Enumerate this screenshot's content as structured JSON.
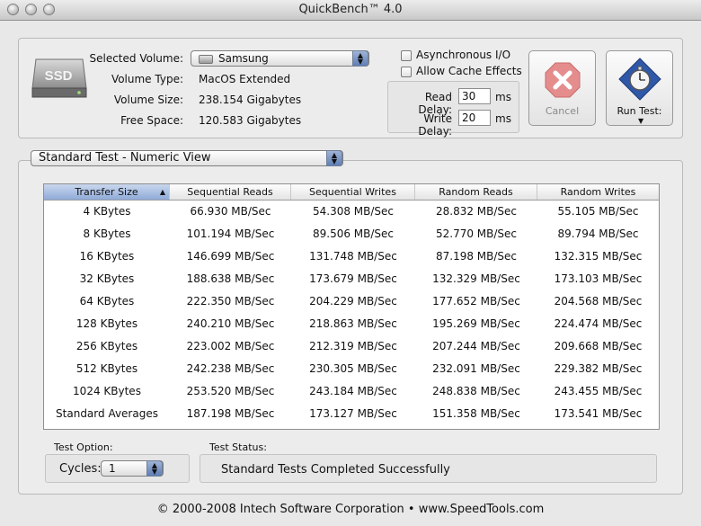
{
  "window": {
    "title": "QuickBench™ 4.0"
  },
  "volume": {
    "selected_label": "Selected Volume:",
    "selected_value": "Samsung",
    "type_label": "Volume Type:",
    "type_value": "MacOS Extended",
    "size_label": "Volume Size:",
    "size_value": "238.154 Gigabytes",
    "free_label": "Free Space:",
    "free_value": "120.583 Gigabytes",
    "icon_text": "SSD"
  },
  "options": {
    "async_label": "Asynchronous I/O",
    "async_checked": false,
    "cache_label": "Allow Cache Effects",
    "cache_checked": false,
    "read_delay_label": "Read Delay:",
    "read_delay_value": "30",
    "write_delay_label": "Write Delay:",
    "write_delay_value": "20",
    "unit": "ms"
  },
  "buttons": {
    "cancel_label": "Cancel",
    "run_label": "Run Test:"
  },
  "view_select": {
    "value": "Standard Test - Numeric View"
  },
  "table": {
    "headers": [
      "Transfer Size",
      "Sequential Reads",
      "Sequential Writes",
      "Random Reads",
      "Random Writes"
    ],
    "rows": [
      [
        "4 KBytes",
        "66.930 MB/Sec",
        "54.308 MB/Sec",
        "28.832 MB/Sec",
        "55.105 MB/Sec"
      ],
      [
        "8 KBytes",
        "101.194 MB/Sec",
        "89.506 MB/Sec",
        "52.770 MB/Sec",
        "89.794 MB/Sec"
      ],
      [
        "16 KBytes",
        "146.699 MB/Sec",
        "131.748 MB/Sec",
        "87.198 MB/Sec",
        "132.315 MB/Sec"
      ],
      [
        "32 KBytes",
        "188.638 MB/Sec",
        "173.679 MB/Sec",
        "132.329 MB/Sec",
        "173.103 MB/Sec"
      ],
      [
        "64 KBytes",
        "222.350 MB/Sec",
        "204.229 MB/Sec",
        "177.652 MB/Sec",
        "204.568 MB/Sec"
      ],
      [
        "128 KBytes",
        "240.210 MB/Sec",
        "218.863 MB/Sec",
        "195.269 MB/Sec",
        "224.474 MB/Sec"
      ],
      [
        "256 KBytes",
        "223.002 MB/Sec",
        "212.319 MB/Sec",
        "207.244 MB/Sec",
        "209.668 MB/Sec"
      ],
      [
        "512 KBytes",
        "242.238 MB/Sec",
        "230.305 MB/Sec",
        "232.091 MB/Sec",
        "229.382 MB/Sec"
      ],
      [
        "1024 KBytes",
        "253.520 MB/Sec",
        "243.184 MB/Sec",
        "248.838 MB/Sec",
        "243.455 MB/Sec"
      ],
      [
        "Standard Averages",
        "187.198 MB/Sec",
        "173.127 MB/Sec",
        "151.358 MB/Sec",
        "173.541 MB/Sec"
      ]
    ]
  },
  "test_option": {
    "label": "Test Option:",
    "cycles_label": "Cycles:",
    "cycles_value": "1"
  },
  "test_status": {
    "label": "Test Status:",
    "value": "Standard Tests Completed Successfully"
  },
  "footer": {
    "text": "© 2000-2008 Intech Software Corporation • www.SpeedTools.com"
  },
  "colors": {
    "cancel_x": "#e07070",
    "run_icon_blue": "#2f58a8",
    "sort_header": "#9db3de"
  },
  "icons": [
    "ssd-drive-icon",
    "disk-icon",
    "cancel-x-icon",
    "stopwatch-icon",
    "sort-ascending-icon"
  ]
}
